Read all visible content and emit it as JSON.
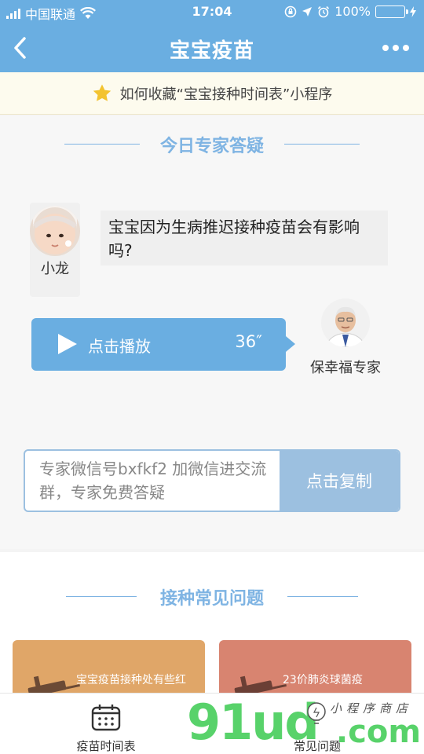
{
  "status_bar": {
    "carrier": "中国联通",
    "time": "17:04",
    "battery_percent": "100%"
  },
  "nav": {
    "title": "宝宝疫苗"
  },
  "tip": {
    "text": "如何收藏“宝宝接种时间表”小程序"
  },
  "expert_qa": {
    "title": "今日专家答疑",
    "asker_name": "小龙",
    "question": "宝宝因为生病推迟接种疫苗会有影响吗?",
    "voice_label": "点击播放",
    "voice_duration": "36″",
    "expert_name": "保幸福专家",
    "wechat_text": "专家微信号bxfkf2 加微信进交流群，专家免费答疑",
    "copy_button": "点击复制"
  },
  "faq": {
    "title": "接种常见问题",
    "cards": [
      {
        "text": "宝宝疫苗接种处有些红",
        "color": "#e0a668"
      },
      {
        "text": "23价肺炎球菌疫",
        "color": "#d88470"
      }
    ]
  },
  "tabbar": {
    "tabs": [
      {
        "label": "疫苗时间表"
      },
      {
        "label": "常见问题"
      }
    ]
  },
  "watermark": {
    "main": "91ud",
    "suffix": ".com",
    "script": "小程序商店"
  },
  "colors": {
    "brand_blue": "#6aaee1",
    "light_blue": "#9cc0e0",
    "watermark_green": "#58d26a"
  }
}
